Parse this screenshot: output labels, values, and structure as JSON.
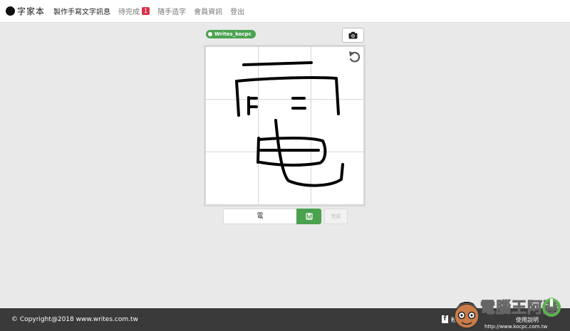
{
  "nav": {
    "logo_text": "字家本",
    "items": [
      {
        "label": "製作手寫文字訊息",
        "active": true
      },
      {
        "label": "待完成",
        "badge": "1"
      },
      {
        "label": "隨手造字"
      },
      {
        "label": "會員資訊"
      },
      {
        "label": "登出"
      }
    ]
  },
  "editor": {
    "user_tag": "Writes_kocpc",
    "answer_value": "電",
    "done_label": "完成",
    "camera_icon": "camera-icon",
    "undo_icon": "undo-icon",
    "submit_icon": "save-icon"
  },
  "footer": {
    "copyright": "© Copyright@2018 www.writes.com.tw",
    "links": [
      "粉絲專頁",
      "使用說明"
    ]
  },
  "watermark": {
    "text": "電腦王阿達",
    "url": "http://www.kocpc.com.tw"
  },
  "colors": {
    "accent_green": "#4aa24f",
    "badge_red": "#d9334b",
    "footer_bg": "#3a3a3a"
  }
}
